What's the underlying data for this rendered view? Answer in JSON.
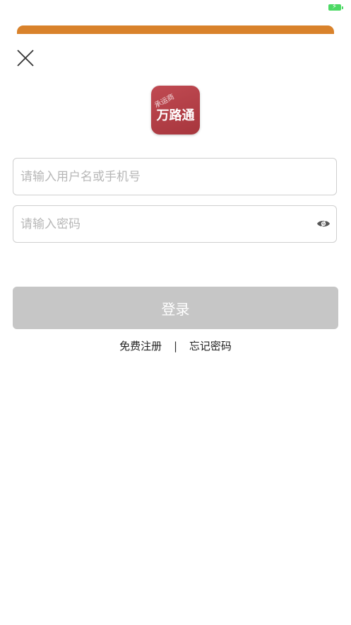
{
  "status_bar": {
    "battery_icon": "battery-charging-icon",
    "battery_color": "#4cd964"
  },
  "header": {
    "accent_color": "#d9822b",
    "close_icon": "close-icon"
  },
  "logo": {
    "small_text": "承运商",
    "main_text": "万路通",
    "color": "#b0404a"
  },
  "form": {
    "username_placeholder": "请输入用户名或手机号",
    "username_value": "",
    "password_placeholder": "请输入密码",
    "password_value": "",
    "eye_icon": "eye-icon"
  },
  "login_button": {
    "label": "登录",
    "background": "#c6c6c6"
  },
  "links": {
    "register": "免费注册",
    "separator": "|",
    "forgot": "忘记密码"
  }
}
